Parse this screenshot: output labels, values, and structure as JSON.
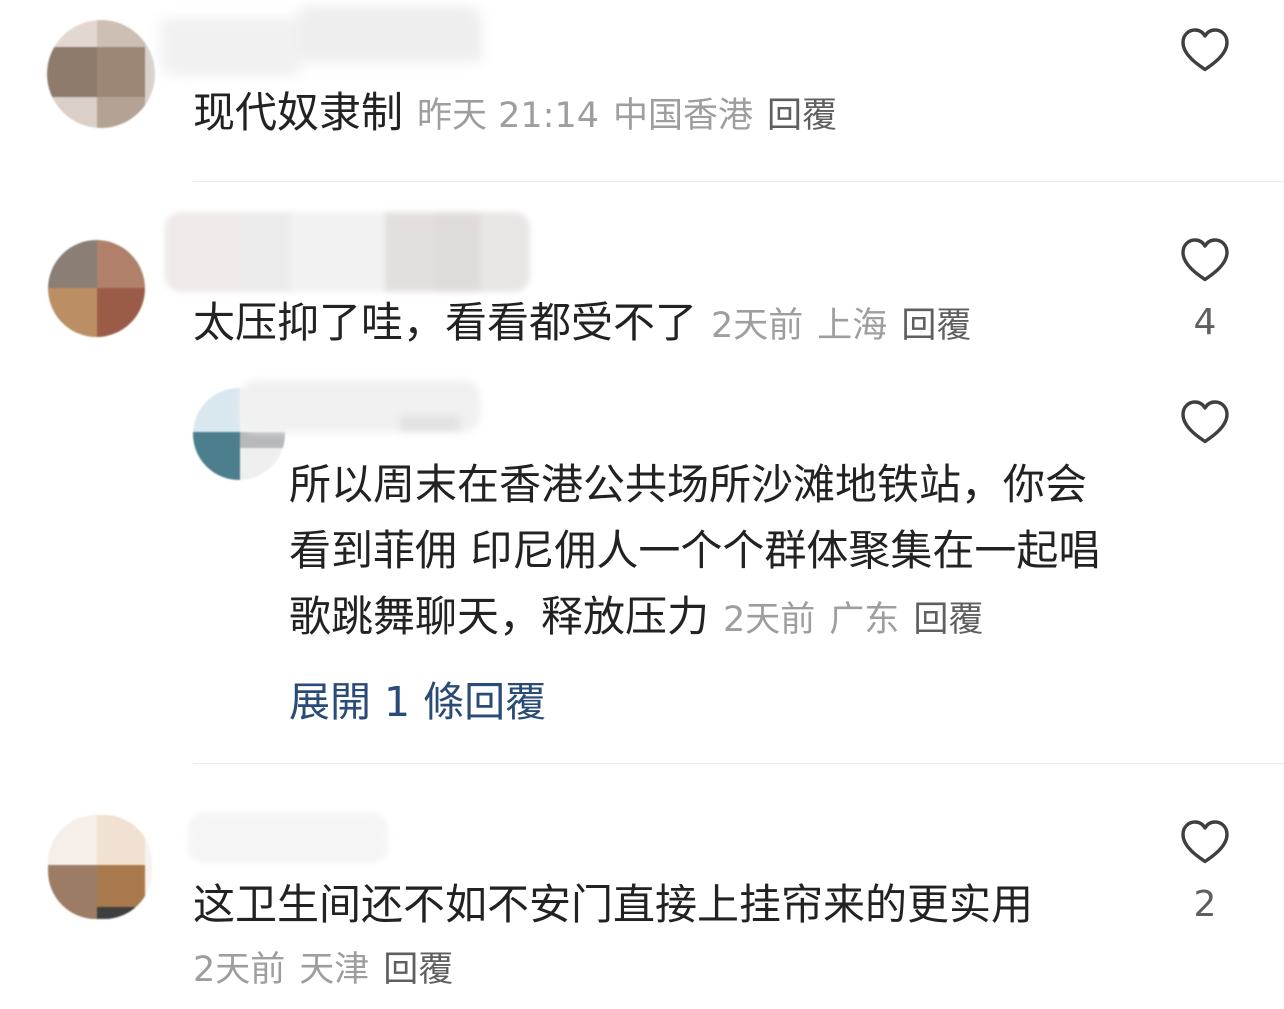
{
  "colors": {
    "background": "#ffffff",
    "text": "#222222",
    "meta": "#9e9e9e",
    "reply_action": "#5f5f5f",
    "expand_link": "#2a4b77",
    "divider": "#ebebeb",
    "like_icon": "#3f3f3f",
    "count_text": "#5f5f5f"
  },
  "comments": [
    {
      "text": "现代奴隶制",
      "time": "昨天 21:14",
      "location": "中国香港",
      "reply_label": "回覆",
      "like_icon": "heart-outline-icon"
    },
    {
      "text": "太压抑了哇，看看都受不了",
      "time": "2天前",
      "location": "上海",
      "reply_label": "回覆",
      "like_icon": "heart-outline-icon",
      "like_count": "4",
      "replies": [
        {
          "text_lines": [
            "所以周末在香港公共场所沙滩地铁站，你会",
            "看到菲佣 印尼佣人一个个群体聚集在一起唱",
            "歌跳舞聊天，释放压力"
          ],
          "time": "2天前",
          "location": "广东",
          "reply_label": "回覆",
          "like_icon": "heart-outline-icon"
        }
      ],
      "expand_replies_label": "展開 1 條回覆"
    },
    {
      "text": "这卫生间还不如不安门直接上挂帘来的更实用",
      "time": "2天前",
      "location": "天津",
      "reply_label": "回覆",
      "like_icon": "heart-outline-icon",
      "like_count": "2"
    }
  ]
}
